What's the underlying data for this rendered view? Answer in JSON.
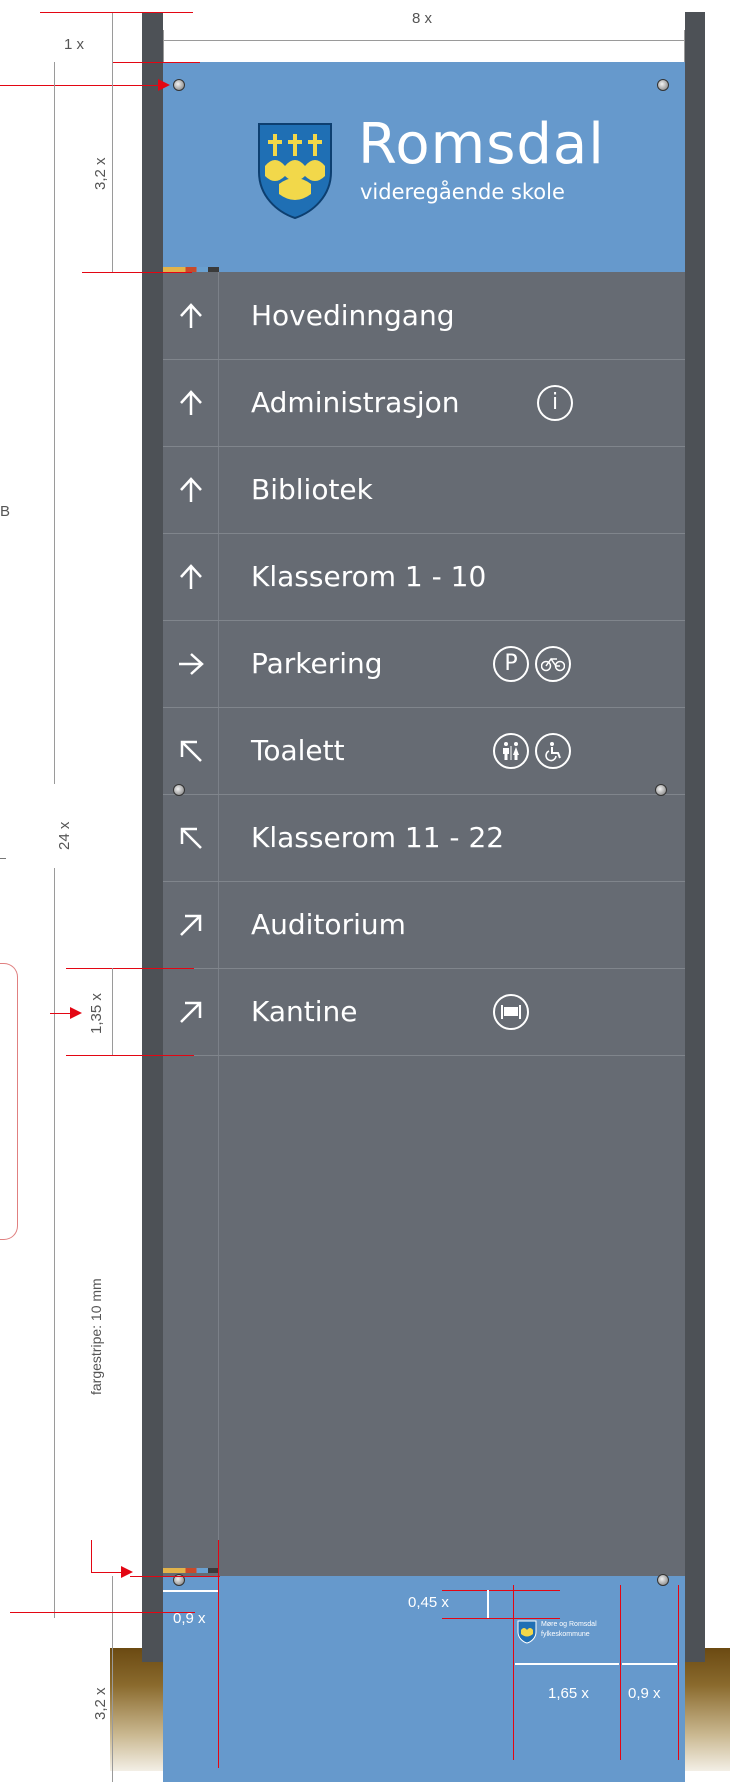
{
  "colors": {
    "sign_blue": "#6699cc",
    "sign_grey": "#666b73",
    "post": "#4d5156",
    "dimension_red": "#e30613",
    "crest_blue": "#1f6fb4",
    "crest_yellow": "#f2d84a"
  },
  "header": {
    "name": "Romsdal",
    "subtitle": "videregående skole",
    "crest_icon": "coat-of-arms-icon"
  },
  "rows": [
    {
      "arrow": "↑",
      "arrow_icon": "arrow-up-icon",
      "label": "Hovedinngang",
      "icons": []
    },
    {
      "arrow": "↑",
      "arrow_icon": "arrow-up-icon",
      "label": "Administrasjon",
      "icons": [
        "info-icon"
      ]
    },
    {
      "arrow": "↑",
      "arrow_icon": "arrow-up-icon",
      "label": "Bibliotek",
      "icons": []
    },
    {
      "arrow": "↑",
      "arrow_icon": "arrow-up-icon",
      "label": "Klasserom 1 - 10",
      "icons": []
    },
    {
      "arrow": "→",
      "arrow_icon": "arrow-right-icon",
      "label": "Parkering",
      "icons": [
        "parking-icon",
        "bicycle-icon"
      ]
    },
    {
      "arrow": "↖",
      "arrow_icon": "arrow-up-left-icon",
      "label": "Toalett",
      "icons": [
        "toilet-icon",
        "wheelchair-icon"
      ]
    },
    {
      "arrow": "↖",
      "arrow_icon": "arrow-up-left-icon",
      "label": "Klasserom 11 - 22",
      "icons": []
    },
    {
      "arrow": "↗",
      "arrow_icon": "arrow-up-right-icon",
      "label": "Auditorium",
      "icons": []
    },
    {
      "arrow": "↗",
      "arrow_icon": "arrow-up-right-icon",
      "label": "Kantine",
      "icons": [
        "cafeteria-icon"
      ]
    }
  ],
  "icon_glyphs": {
    "info": "i",
    "parking": "P"
  },
  "footer": {
    "logo_text_1": "Møre og Romsdal",
    "logo_text_2": "fylkeskommune"
  },
  "dimensions": {
    "width": "8 x",
    "top_offset": "1 x",
    "header_height": "3,2 x",
    "total_height": "24 x",
    "row_height": "1,35 x",
    "stripe_note": "fargestripe: 10 mm",
    "margin": "0,9 x",
    "footer_logo_height": "0,45 x",
    "footer_logo_width": "1,65 x",
    "footer_margin": "0,9 x",
    "footer_height": "3,2 x",
    "side_note": "B"
  }
}
